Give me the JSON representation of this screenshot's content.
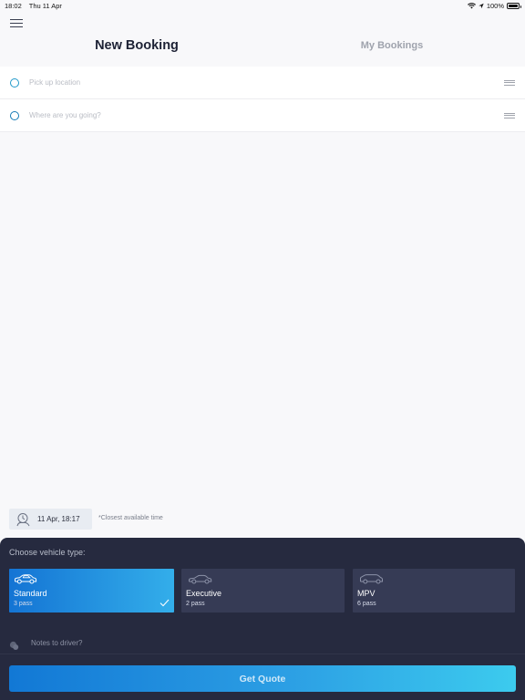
{
  "status_bar": {
    "time": "18:02",
    "date": "Thu 11 Apr",
    "battery": "100%",
    "icons": [
      "wifi-icon",
      "location-arrow-icon",
      "battery-icon"
    ]
  },
  "header": {
    "menu_icon": "hamburger-menu-icon",
    "tabs": [
      {
        "label": "New Booking",
        "active": true
      },
      {
        "label": "My Bookings",
        "active": false
      }
    ]
  },
  "locations": {
    "pickup": {
      "placeholder": "Pick up location",
      "value": ""
    },
    "destination": {
      "placeholder": "Where are you going?",
      "value": ""
    }
  },
  "schedule": {
    "date_time": "11 Apr, 18:17",
    "note": "*Closest available time"
  },
  "vehicle_selector": {
    "title": "Choose vehicle type:",
    "options": [
      {
        "name": "Standard",
        "pass": "3 pass",
        "selected": true
      },
      {
        "name": "Executive",
        "pass": "2 pass",
        "selected": false
      },
      {
        "name": "MPV",
        "pass": "6 pass",
        "selected": false
      }
    ]
  },
  "notes": {
    "placeholder": "Notes to driver?",
    "value": ""
  },
  "actions": {
    "get_quote": "Get Quote"
  },
  "colors": {
    "accent_start": "#1474d4",
    "accent_end": "#3ccbee",
    "sheet_bg": "#262a3f",
    "card_bg": "#363b55",
    "title_dark": "#1d2235"
  }
}
